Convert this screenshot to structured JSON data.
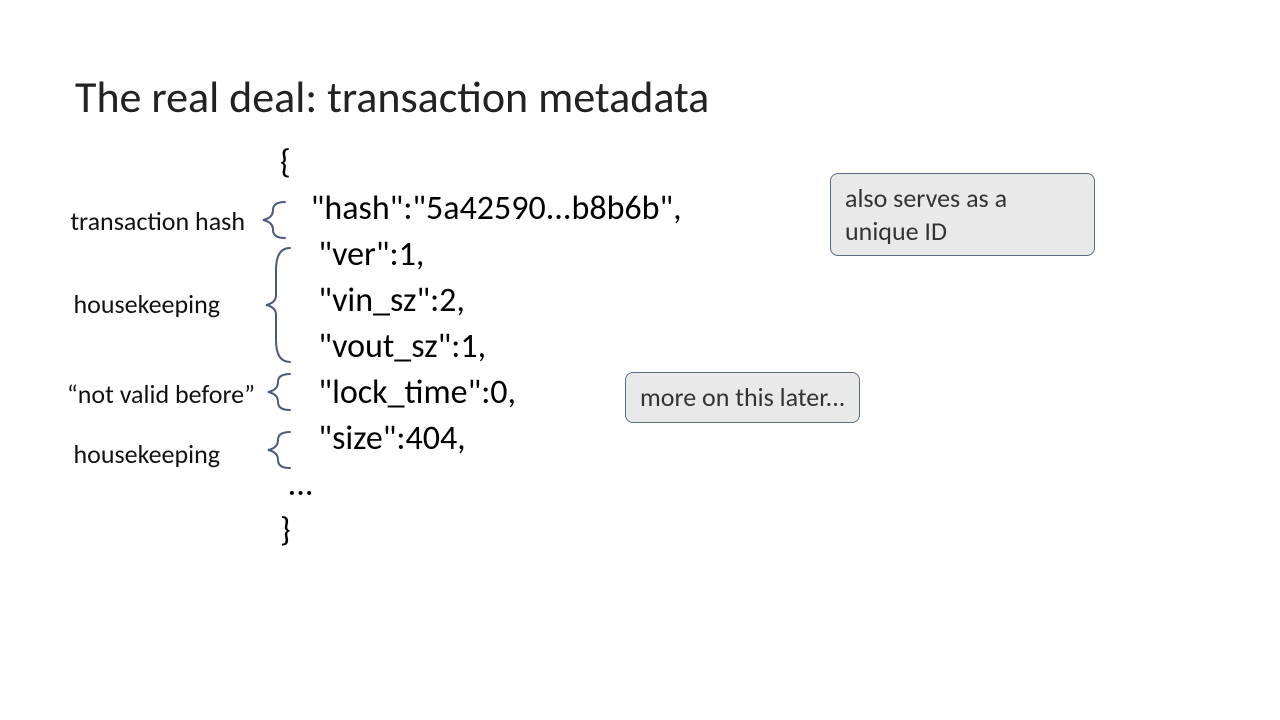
{
  "title": "The real deal: transaction metadata",
  "code": {
    "open": "{",
    "line_hash": "    \"hash\":\"5a42590...b8b6b\",",
    "line_ver": "     \"ver\":1,",
    "line_vin_sz": "     \"vin_sz\":2,",
    "line_vout_sz": "     \"vout_sz\":1,",
    "line_lock_time": "     \"lock_time\":0,",
    "line_size": "     \"size\":404,",
    "ellipsis": " ...",
    "close": "}"
  },
  "labels": {
    "transaction_hash": "transaction hash",
    "housekeeping_1": "housekeeping",
    "not_valid_before": "“not valid before”",
    "housekeeping_2": "housekeeping"
  },
  "callouts": {
    "unique_id": "also serves as a unique ID",
    "more_later": "more on this later..."
  }
}
